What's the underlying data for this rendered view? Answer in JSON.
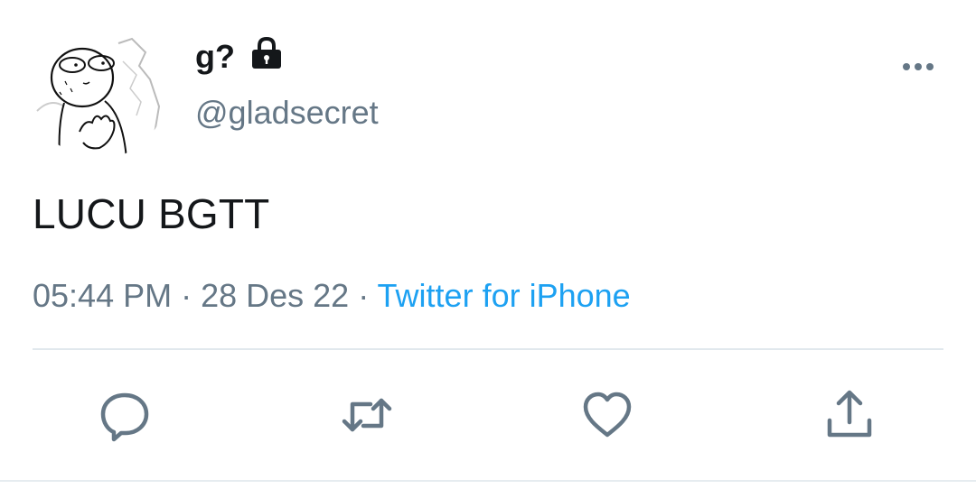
{
  "tweet": {
    "author": {
      "display_name": "g?",
      "handle": "@gladsecret",
      "protected_icon": "lock-icon",
      "avatar_icon": "avatar-drawing"
    },
    "text": "LUCU BGTT",
    "meta": {
      "time": "05:44 PM",
      "separator": " · ",
      "date": "28 Des 22",
      "source": "Twitter for iPhone"
    },
    "menu_icon": "more-icon",
    "actions": [
      {
        "name": "reply",
        "icon": "reply-icon"
      },
      {
        "name": "retweet",
        "icon": "retweet-icon"
      },
      {
        "name": "like",
        "icon": "heart-icon"
      },
      {
        "name": "share",
        "icon": "share-icon"
      }
    ]
  },
  "colors": {
    "text_primary": "#14171a",
    "text_secondary": "#657786",
    "link": "#1da1f2",
    "divider": "#e1e8ed"
  }
}
